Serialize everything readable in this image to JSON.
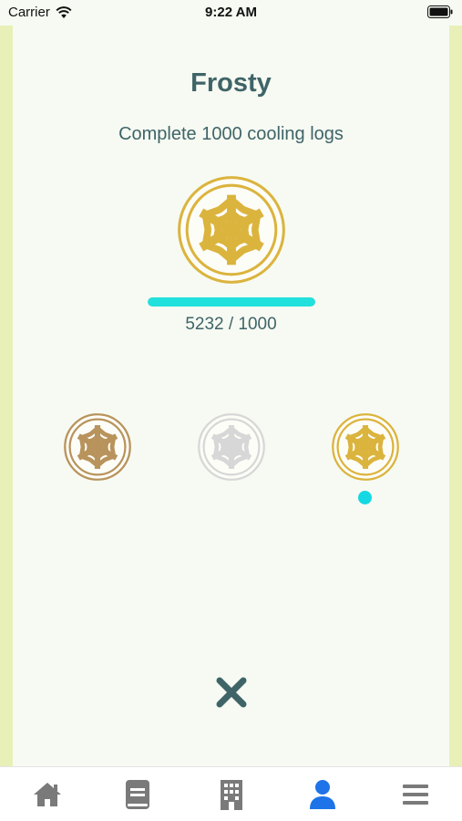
{
  "status_bar": {
    "carrier": "Carrier",
    "time": "9:22 AM"
  },
  "achievement": {
    "title": "Frosty",
    "description": "Complete 1000 cooling logs",
    "progress_text": "5232 / 1000",
    "progress_fraction": 1.0
  },
  "tiers": [
    {
      "name": "bronze",
      "color": "#b8935c"
    },
    {
      "name": "silver",
      "color": "#d7d7d7"
    },
    {
      "name": "gold",
      "color": "#dbb43e",
      "selected": true
    }
  ],
  "colors": {
    "accent": "#22e0dc",
    "text": "#3f6468",
    "active_tab": "#1e73e8",
    "inactive_tab": "#7a7a7a"
  },
  "tab_bar": {
    "items": [
      {
        "icon": "home-icon"
      },
      {
        "icon": "book-icon"
      },
      {
        "icon": "building-icon"
      },
      {
        "icon": "profile-icon",
        "active": true
      },
      {
        "icon": "menu-icon"
      }
    ]
  }
}
